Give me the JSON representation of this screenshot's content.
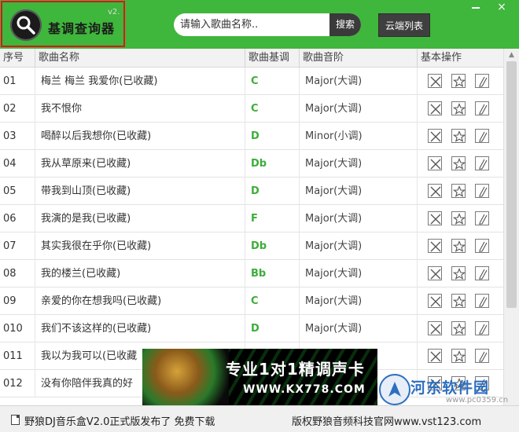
{
  "app": {
    "title": "基调查询器",
    "version": "v2."
  },
  "search": {
    "placeholder": "请输入歌曲名称..",
    "button_label": "搜索"
  },
  "cloud_button_label": "云端列表",
  "window_controls": {
    "close": "×"
  },
  "table": {
    "headers": [
      "序号",
      "歌曲名称",
      "歌曲基调",
      "歌曲音阶",
      "基本操作"
    ],
    "rows": [
      {
        "num": "01",
        "name": "梅兰 梅兰 我爱你(已收藏)",
        "key": "C",
        "mode": "Major(大调)"
      },
      {
        "num": "02",
        "name": "我不恨你",
        "key": "C",
        "mode": "Major(大调)"
      },
      {
        "num": "03",
        "name": "喝醉以后我想你(已收藏)",
        "key": "D",
        "mode": "Minor(小调)"
      },
      {
        "num": "04",
        "name": "我从草原来(已收藏)",
        "key": "Db",
        "mode": "Major(大调)"
      },
      {
        "num": "05",
        "name": "带我到山顶(已收藏)",
        "key": "D",
        "mode": "Major(大调)"
      },
      {
        "num": "06",
        "name": "我演的是我(已收藏)",
        "key": "F",
        "mode": "Major(大调)"
      },
      {
        "num": "07",
        "name": "其实我很在乎你(已收藏)",
        "key": "Db",
        "mode": "Major(大调)"
      },
      {
        "num": "08",
        "name": "我的楼兰(已收藏)",
        "key": "Bb",
        "mode": "Major(大调)"
      },
      {
        "num": "09",
        "name": "亲爱的你在想我吗(已收藏)",
        "key": "C",
        "mode": "Major(大调)"
      },
      {
        "num": "010",
        "name": "我们不该这样的(已收藏)",
        "key": "D",
        "mode": "Major(大调)"
      },
      {
        "num": "011",
        "name": "我以为我可以(已收藏",
        "key": "",
        "mode": ""
      },
      {
        "num": "012",
        "name": "没有你陪伴我真的好",
        "key": "",
        "mode": ""
      }
    ]
  },
  "ad": {
    "headline": "专业1对1精调声卡",
    "url": "WWW.KX778.COM"
  },
  "watermark": {
    "name": "河东软件园",
    "url": "www.pc0359.cn"
  },
  "status": {
    "left": "野狼DJ音乐盒V2.0正式版发布了 免费下载",
    "right": "版权野狼音频科技官网www.vst123.com"
  },
  "icons": {
    "logo": "magnifier-icon",
    "delete": "close-box-icon",
    "favorite": "star-icon",
    "edit": "edit-icon",
    "status": "document-icon"
  },
  "colors": {
    "accent": "#3fb63c",
    "key_text": "#3dad3a",
    "highlight_border": "#e0141b",
    "dark_button": "#3f3f3f"
  }
}
